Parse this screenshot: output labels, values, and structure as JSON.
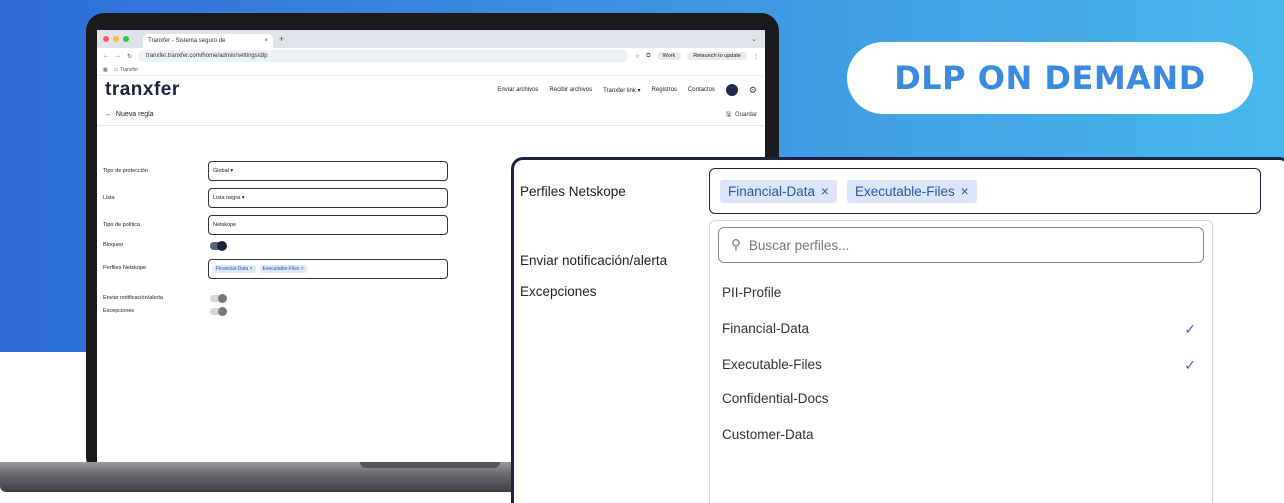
{
  "badge": {
    "text": "DLP ON DEMAND"
  },
  "browser": {
    "tab_title": "Tranxfer - Sistema seguro de",
    "tab_close": "×",
    "new_tab": "+",
    "url": "tranxfer.tranxfer.com/home/admin/settings/dlp",
    "profile_label": "Work",
    "relaunch_label": "Relaunch to update",
    "bookmark_label": "Tranxfer"
  },
  "app": {
    "logo": "tranxfer",
    "nav": [
      "Enviar archivos",
      "Recibir archivos",
      "Tranxfer link ▾",
      "Registros",
      "Contactos"
    ],
    "back_title": "Nueva regla",
    "save_label": "Guardar"
  },
  "form": {
    "labels": {
      "protection_type": "Tipo de protección",
      "list": "Lista",
      "policy_type": "Tipo de política",
      "block": "Bloqueo",
      "profiles": "Perfiles Netskope",
      "notify": "Enviar notificación/alerta",
      "exceptions": "Excepciones"
    },
    "values": {
      "protection_type": "Global ▾",
      "list": "Lista negra ▾",
      "policy_type": "Netskope"
    },
    "block_enabled": true,
    "notify_enabled": false,
    "exceptions_enabled": false,
    "selected_profiles": [
      "Financial-Data ×",
      "Executable-Files ×"
    ]
  },
  "zoom": {
    "profiles_label": "Perfiles Netskope",
    "notify_label": "Enviar notificación/alerta",
    "exceptions_label": "Excepciones",
    "chips": [
      "Financial-Data",
      "Executable-Files"
    ],
    "search_placeholder": "Buscar perfiles...",
    "options": [
      {
        "label": "PII-Profile",
        "checked": false
      },
      {
        "label": "Financial-Data",
        "checked": true
      },
      {
        "label": "Executable-Files",
        "checked": true
      },
      {
        "label": "Confidential-Docs",
        "checked": false
      },
      {
        "label": "Customer-Data",
        "checked": false
      }
    ]
  },
  "colors": {
    "brand": "#1c2340",
    "accent": "#3a8ae0",
    "chip_bg": "#dbe6fa"
  }
}
